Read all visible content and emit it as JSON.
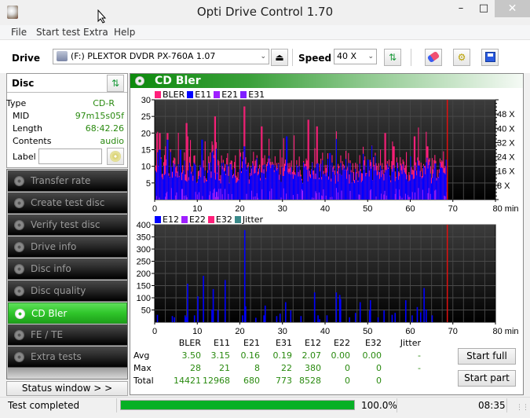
{
  "window": {
    "title": "Opti Drive Control 1.70",
    "minimize": "–",
    "maximize": "□",
    "close": "✕"
  },
  "menu": [
    "File",
    "Start test",
    "Extra",
    "Help"
  ],
  "toolbar": {
    "drive_label": "Drive",
    "drive_value": "(F:)  PLEXTOR DVDR   PX-760A 1.07",
    "speed_label": "Speed",
    "speed_value": "40 X"
  },
  "disc": {
    "title": "Disc",
    "fields": [
      {
        "label": "Type",
        "value": "CD-R"
      },
      {
        "label": "MID",
        "value": "97m15s05f"
      },
      {
        "label": "Length",
        "value": "68:42.26"
      },
      {
        "label": "Contents",
        "value": "audio"
      }
    ],
    "label_field_label": "Label",
    "label_value": ""
  },
  "nav": [
    {
      "label": "Transfer rate",
      "active": false
    },
    {
      "label": "Create test disc",
      "active": false
    },
    {
      "label": "Verify test disc",
      "active": false
    },
    {
      "label": "Drive info",
      "active": false
    },
    {
      "label": "Disc info",
      "active": false
    },
    {
      "label": "Disc quality",
      "active": false
    },
    {
      "label": "CD Bler",
      "active": true
    },
    {
      "label": "FE / TE",
      "active": false
    },
    {
      "label": "Extra tests",
      "active": false
    }
  ],
  "status_window_button": "Status window > >",
  "panel": {
    "title": "CD Bler"
  },
  "colors": {
    "bler": "#ff1f7a",
    "e11": "#0000ff",
    "e21": "#9f1fff",
    "e31": "#7f1fff",
    "e12": "#0000ff",
    "e22": "#9f1fff",
    "e32": "#ff1f7a",
    "jitter": "#3a8a8a",
    "marker": "#e01010",
    "accent_green": "#2fc52a",
    "value_green": "#2a8a10"
  },
  "chart_data": [
    {
      "type": "bar",
      "title": "CD Bler - upper",
      "legend": [
        "BLER",
        "E11",
        "E21",
        "E31"
      ],
      "legend_placement": "top-left",
      "xlabel": "min",
      "x_ticks": [
        "0",
        "10",
        "20",
        "30",
        "40",
        "50",
        "60",
        "70",
        "80 min"
      ],
      "xlim": [
        0,
        80
      ],
      "y_ticks": [
        "5",
        "10",
        "15",
        "20",
        "25",
        "30"
      ],
      "ylim": [
        0,
        30
      ],
      "y2_ticks": [
        "8 X",
        "16 X",
        "24 X",
        "32 X",
        "40 X",
        "48 X"
      ],
      "y2lim": [
        0,
        56
      ],
      "grid": true,
      "end_marker_min": 68.7,
      "series_peaks": {
        "BLER": [
          [
            1,
            20
          ],
          [
            3,
            20
          ],
          [
            7.4,
            23
          ],
          [
            7.6,
            19
          ],
          [
            14,
            25
          ],
          [
            21,
            28
          ],
          [
            25,
            22
          ],
          [
            36,
            24
          ],
          [
            38,
            22
          ],
          [
            54,
            20
          ],
          [
            56,
            16
          ],
          [
            61,
            19
          ],
          [
            64,
            16
          ]
        ],
        "E11": [
          [
            1,
            15
          ],
          [
            3,
            18
          ],
          [
            6,
            15
          ],
          [
            11,
            18
          ],
          [
            21,
            16
          ],
          [
            31,
            19
          ],
          [
            41,
            14
          ],
          [
            50,
            12
          ],
          [
            60,
            13
          ],
          [
            68.5,
            12
          ]
        ]
      },
      "e11_baseline_approx": 8,
      "bler_baseline_approx": 9
    },
    {
      "type": "bar",
      "title": "CD Bler - lower",
      "legend": [
        "E12",
        "E22",
        "E32",
        "Jitter"
      ],
      "legend_placement": "top-left",
      "xlabel": "min",
      "x_ticks": [
        "0",
        "10",
        "20",
        "30",
        "40",
        "50",
        "60",
        "70",
        "80 min"
      ],
      "xlim": [
        0,
        80
      ],
      "y_ticks": [
        "50",
        "100",
        "150",
        "200",
        "250",
        "300",
        "350",
        "400"
      ],
      "ylim": [
        0,
        400
      ],
      "grid": true,
      "end_marker_min": 68.7,
      "series": [
        {
          "name": "E12",
          "points": [
            [
              0.5,
              30
            ],
            [
              4,
              25
            ],
            [
              4.5,
              20
            ],
            [
              7,
              28
            ],
            [
              7.3,
              20
            ],
            [
              7.6,
              158
            ],
            [
              9.2,
              28
            ],
            [
              10,
              106
            ],
            [
              11.3,
              190
            ],
            [
              13.3,
              52
            ],
            [
              13.6,
              136
            ],
            [
              14.7,
              50
            ],
            [
              16.4,
              173
            ],
            [
              20.5,
              28
            ],
            [
              21,
              378
            ],
            [
              21.2,
              65
            ],
            [
              23.6,
              18
            ],
            [
              25.5,
              28
            ],
            [
              25.8,
              68
            ],
            [
              28.5,
              25
            ],
            [
              29.3,
              35
            ],
            [
              30.6,
              82
            ],
            [
              31.8,
              48
            ],
            [
              34.2,
              25
            ],
            [
              37.4,
              122
            ],
            [
              38.2,
              28
            ],
            [
              38.6,
              12
            ],
            [
              40.3,
              28
            ],
            [
              42.5,
              122
            ],
            [
              43.3,
              112
            ],
            [
              43.5,
              95
            ],
            [
              45.6,
              20
            ],
            [
              47,
              38
            ],
            [
              48.1,
              82
            ],
            [
              50.3,
              48
            ],
            [
              50.5,
              90
            ],
            [
              52.3,
              20
            ],
            [
              53.7,
              48
            ],
            [
              55.6,
              30
            ],
            [
              56.3,
              38
            ],
            [
              58.8,
              90
            ],
            [
              60.3,
              28
            ],
            [
              61.5,
              62
            ],
            [
              62.3,
              40
            ],
            [
              63.1,
              140
            ],
            [
              63.6,
              52
            ],
            [
              65,
              28
            ]
          ]
        },
        {
          "name": "E22",
          "points": []
        },
        {
          "name": "E32",
          "points": []
        },
        {
          "name": "Jitter",
          "points": []
        }
      ]
    }
  ],
  "stats": {
    "columns": [
      "BLER",
      "E11",
      "E21",
      "E31",
      "E12",
      "E22",
      "E32",
      "Jitter"
    ],
    "rows": [
      {
        "label": "Avg",
        "values": [
          "3.50",
          "3.15",
          "0.16",
          "0.19",
          "2.07",
          "0.00",
          "0.00",
          "-"
        ]
      },
      {
        "label": "Max",
        "values": [
          "28",
          "21",
          "8",
          "22",
          "380",
          "0",
          "0",
          "-"
        ]
      },
      {
        "label": "Total",
        "values": [
          "14421",
          "12968",
          "680",
          "773",
          "8528",
          "0",
          "0",
          ""
        ]
      }
    ]
  },
  "buttons": {
    "start_full": "Start full",
    "start_part": "Start part"
  },
  "statusbar": {
    "message": "Test completed",
    "progress_percent": 100.0,
    "progress_text": "100.0%",
    "time": "08:35"
  }
}
